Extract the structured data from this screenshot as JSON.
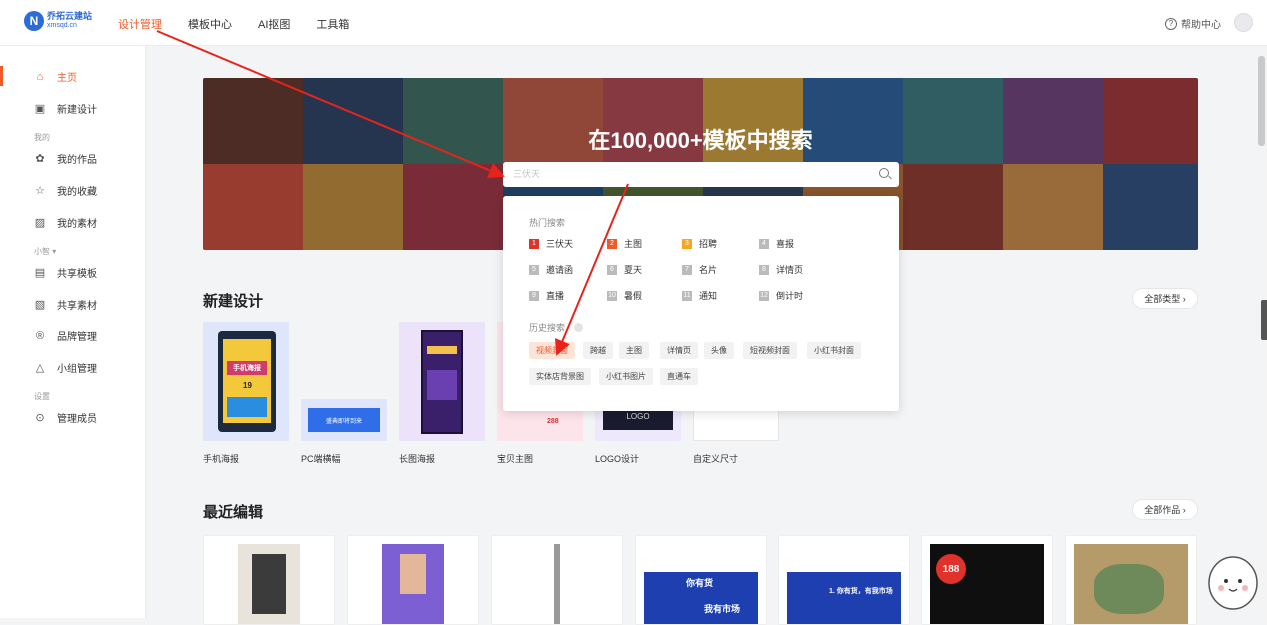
{
  "brand": {
    "name": "乔拓云建站",
    "domain": "xmsqd.cn",
    "mark": "N"
  },
  "nav": {
    "items": [
      "设计管理",
      "模板中心",
      "AI抠图",
      "工具箱"
    ],
    "active_index": 0
  },
  "help_label": "帮助中心",
  "sidebar": {
    "home": "主页",
    "new_design": "新建设计",
    "group_mine": "我的",
    "my_works": "我的作品",
    "my_favorites": "我的收藏",
    "my_materials": "我的素材",
    "group_team": "小智 ▾",
    "shared_templates": "共享模板",
    "shared_materials": "共享素材",
    "brand_mgmt": "品牌管理",
    "team_mgmt": "小组管理",
    "group_settings": "设置",
    "members": "管理成员"
  },
  "banner": {
    "title": "在100,000+模板中搜索"
  },
  "search": {
    "placeholder": "三伏天"
  },
  "dropdown": {
    "hot_label": "热门搜索",
    "hot": [
      {
        "n": "1",
        "t": "三伏天",
        "c": "#e0322b"
      },
      {
        "n": "2",
        "t": "主图",
        "c": "#f05a28"
      },
      {
        "n": "3",
        "t": "招聘",
        "c": "#f5a623"
      },
      {
        "n": "4",
        "t": "喜报",
        "c": "#bbbbbb"
      },
      {
        "n": "5",
        "t": "邀请函",
        "c": "#bbbbbb"
      },
      {
        "n": "6",
        "t": "夏天",
        "c": "#bbbbbb"
      },
      {
        "n": "7",
        "t": "名片",
        "c": "#bbbbbb"
      },
      {
        "n": "8",
        "t": "详情页",
        "c": "#bbbbbb"
      },
      {
        "n": "9",
        "t": "直播",
        "c": "#bbbbbb"
      },
      {
        "n": "10",
        "t": "暑假",
        "c": "#bbbbbb"
      },
      {
        "n": "11",
        "t": "通知",
        "c": "#bbbbbb"
      },
      {
        "n": "12",
        "t": "倒计时",
        "c": "#bbbbbb"
      }
    ],
    "history_label": "历史搜索",
    "history": [
      "视频封面",
      "跨越",
      "主图",
      "详情页",
      "头像",
      "短视频封面",
      "小红书封面",
      "实体店背景图",
      "小红书图片",
      "直通车"
    ]
  },
  "new_design": {
    "title": "新建设计",
    "more": "全部类型 ›",
    "cards": [
      "手机海报",
      "PC端横幅",
      "长图海报",
      "宝贝主图",
      "LOGO设计",
      "自定义尺寸"
    ],
    "poster_text": "手机海报",
    "poster_num": "19",
    "logo_text": "LOGO",
    "banner_text": "盛典即将到来",
    "price_text": "288"
  },
  "recent": {
    "title": "最近编辑",
    "more": "全部作品 ›",
    "thumb_texts": [
      "你有货",
      "我有市场",
      "1. 你有货，有我市场",
      "188"
    ]
  }
}
